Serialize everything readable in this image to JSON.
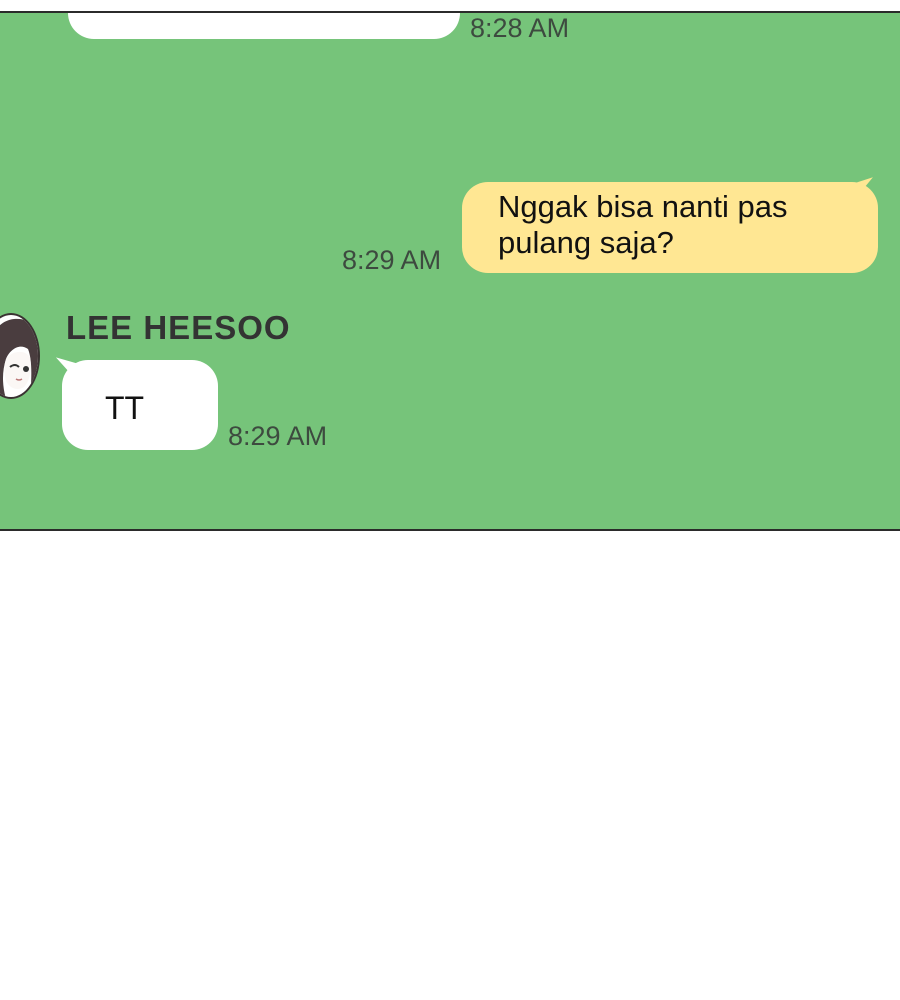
{
  "chat": {
    "messages": [
      {
        "side": "left",
        "text": "",
        "time": "8:28 AM"
      },
      {
        "side": "right",
        "text": "Nggak bisa nanti pas pulang saja?",
        "time": "8:29 AM"
      },
      {
        "side": "left",
        "sender": "LEE HEESOO",
        "text": "TT",
        "time": "8:29 AM"
      }
    ]
  },
  "colors": {
    "background": "#76c47a",
    "outgoing_bubble": "#ffe793",
    "incoming_bubble": "#ffffff",
    "time_text": "#3d4a3f"
  },
  "icons": {
    "avatar": "girl-avatar-icon"
  }
}
